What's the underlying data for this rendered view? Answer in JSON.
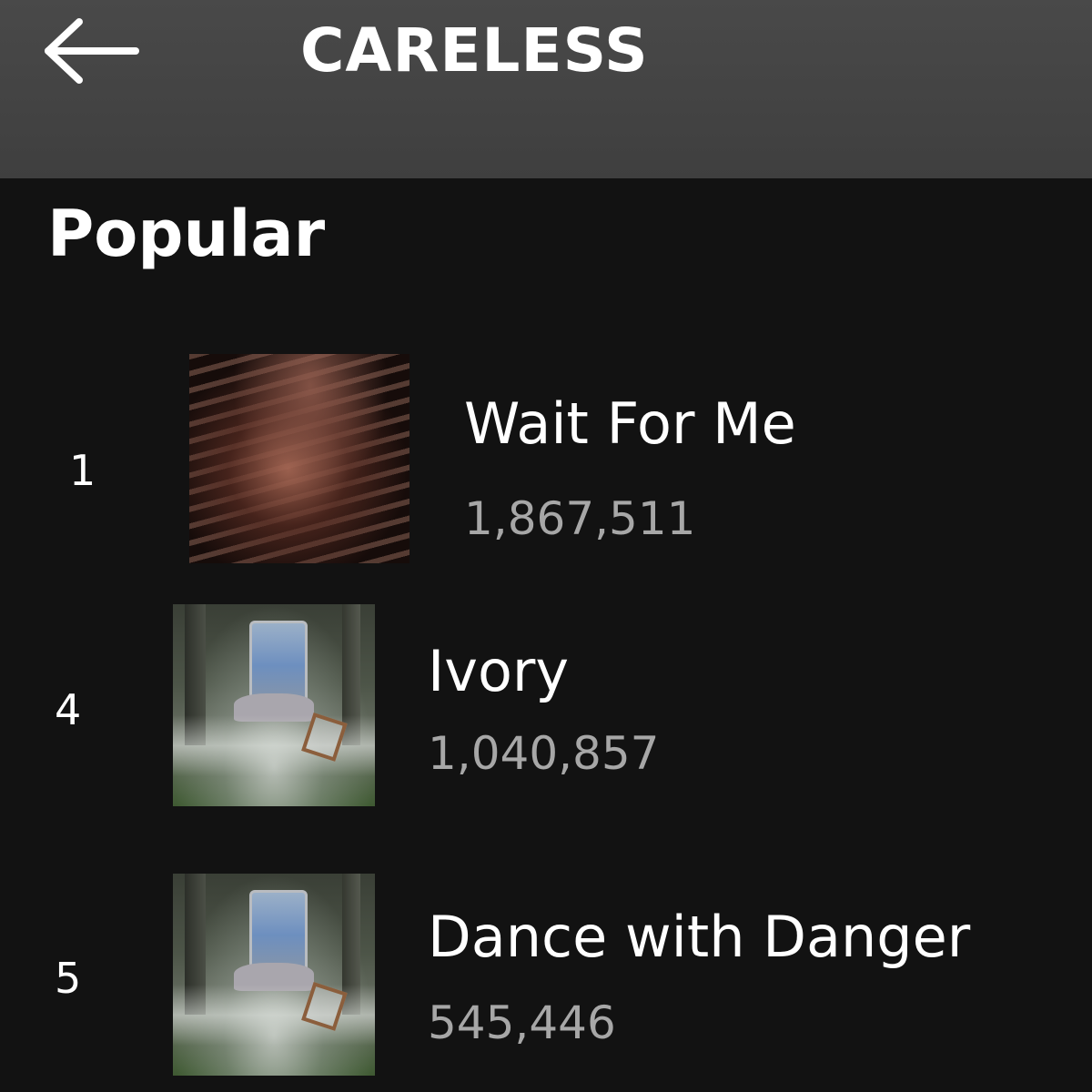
{
  "header": {
    "title": "CARELESS",
    "back_icon": "arrow-left-icon",
    "background_color": "#444444"
  },
  "section": {
    "heading": "Popular"
  },
  "tracks": [
    {
      "rank": "1",
      "title": "Wait For Me",
      "plays": "1,867,511",
      "art_icon": "album-art-wait-for-me"
    },
    {
      "rank": "4",
      "title": "Ivory",
      "plays": "1,040,857",
      "art_icon": "album-art-forest-throne"
    },
    {
      "rank": "5",
      "title": "Dance with Danger",
      "plays": "545,446",
      "art_icon": "album-art-forest-throne"
    }
  ],
  "colors": {
    "background": "#121212",
    "primary_text": "#ffffff",
    "secondary_text": "#a7a7a7"
  }
}
